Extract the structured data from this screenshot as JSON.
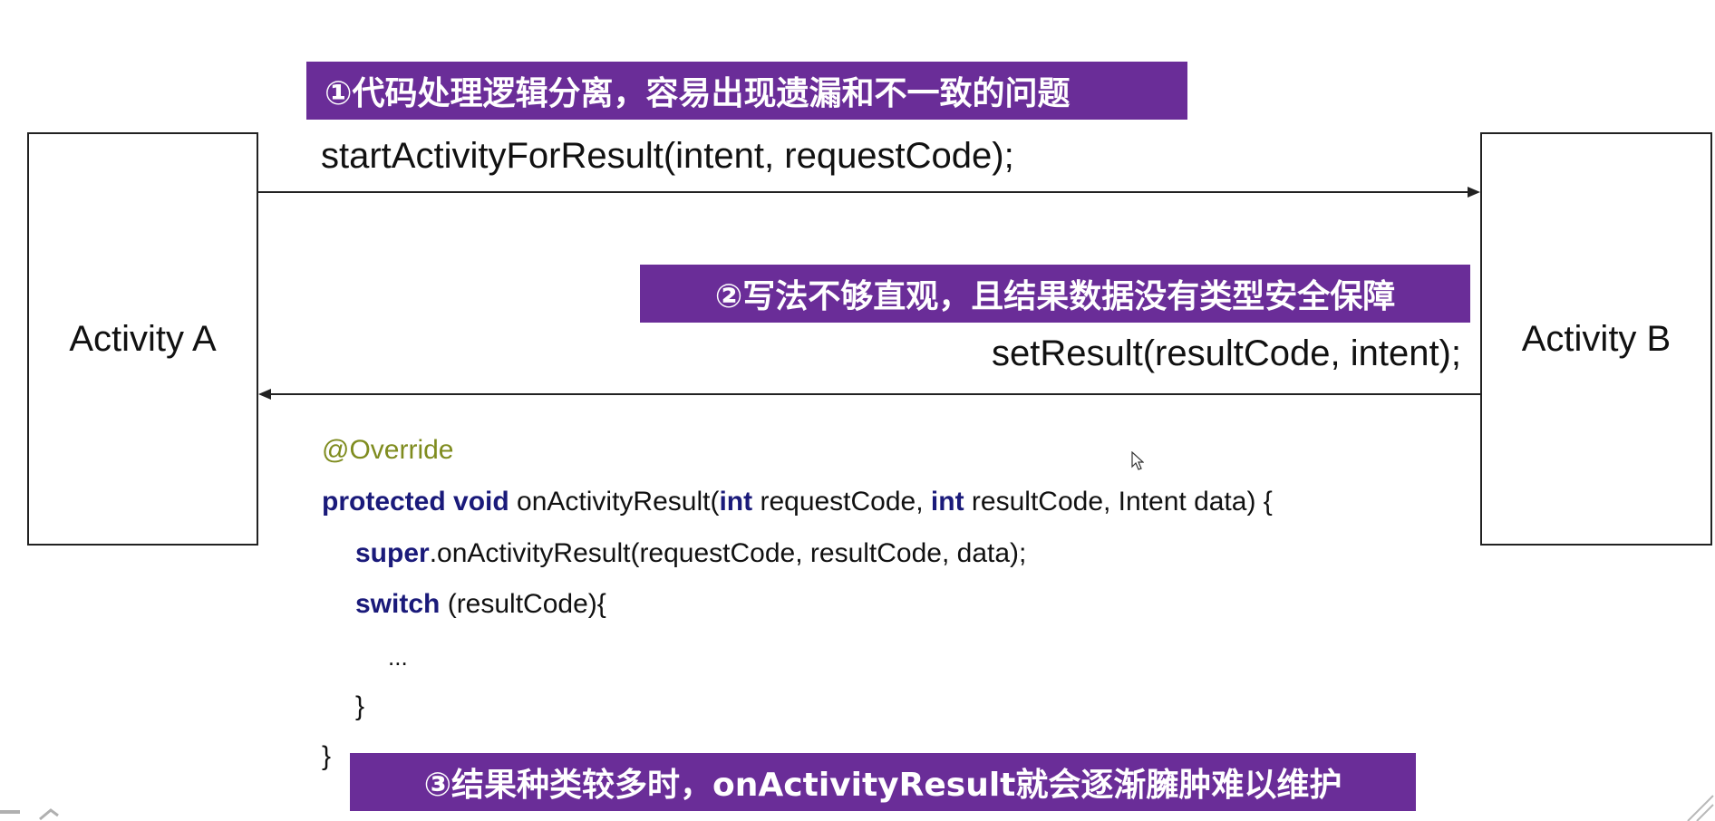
{
  "boxes": {
    "a_label": "Activity A",
    "b_label": "Activity B"
  },
  "banners": {
    "b1": "①代码处理逻辑分离，容易出现遗漏和不一致的问题",
    "b2": "②写法不够直观，且结果数据没有类型安全保障",
    "b3": "③结果种类较多时，onActivityResult就会逐渐臃肿难以维护"
  },
  "calls": {
    "start": "startActivityForResult(intent, requestCode);",
    "set": "setResult(resultCode, intent);"
  },
  "code": {
    "annotation": "@Override",
    "kw_protected": "protected",
    "kw_void": "void",
    "method_name": "onActivityResult(",
    "kw_int": "int",
    "param_request": "requestCode,",
    "param_result": "resultCode, Intent data) {",
    "kw_super": "super",
    "super_call": ".onActivityResult(requestCode, resultCode, data);",
    "kw_switch": "switch",
    "switch_arg": "(resultCode){",
    "ellipsis": "...",
    "close_inner": "}",
    "close_outer": "}"
  },
  "colors": {
    "banner_bg": "#6a2d98",
    "keyword": "#1a1a7a",
    "annotation": "#7f8c1f"
  },
  "icons": [
    "cursor-icon"
  ]
}
